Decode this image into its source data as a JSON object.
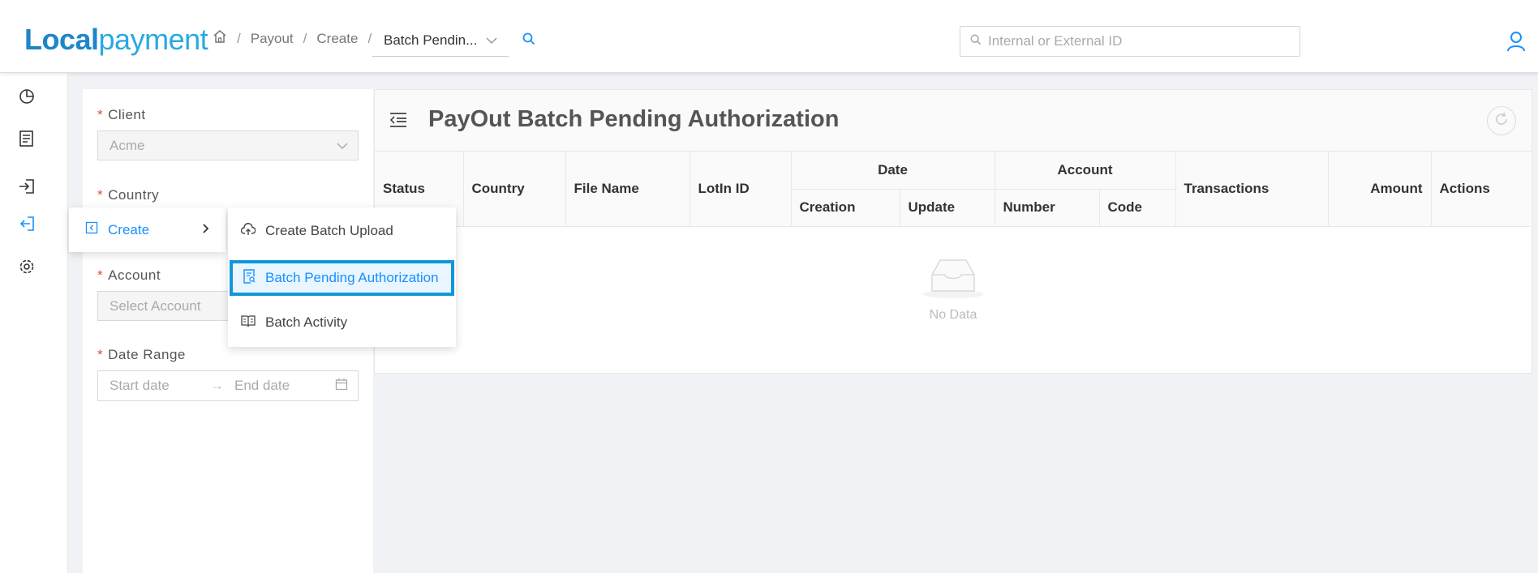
{
  "app": {
    "logo_part1": "Local",
    "logo_part2": "payment"
  },
  "breadcrumb": {
    "items": [
      "Payout",
      "Create"
    ],
    "separator": "/",
    "current": "Batch Pendin..."
  },
  "header": {
    "search_placeholder": "Internal or External ID"
  },
  "filters": {
    "client_label": "Client",
    "client_value": "Acme",
    "country_label": "Country",
    "account_label": "Account",
    "account_placeholder": "Select Account",
    "daterange_label": "Date Range",
    "start_placeholder": "Start date",
    "end_placeholder": "End date",
    "arrow": "→"
  },
  "card": {
    "title": "PayOut Batch Pending Authorization",
    "empty_text": "No Data"
  },
  "table": {
    "headers": {
      "status": "Status",
      "country": "Country",
      "file_name": "File Name",
      "lotin_id": "LotIn ID",
      "date": "Date",
      "creation": "Creation",
      "update": "Update",
      "account": "Account",
      "number": "Number",
      "code": "Code",
      "transactions": "Transactions",
      "amount": "Amount",
      "actions": "Actions"
    }
  },
  "menu": {
    "create_label": "Create",
    "items": [
      {
        "label": "Create Batch Upload",
        "icon": "cloud-upload-icon"
      },
      {
        "label": "Batch Pending Authorization",
        "icon": "file-search-icon"
      },
      {
        "label": "Batch Activity",
        "icon": "book-icon"
      }
    ]
  },
  "colors": {
    "accent": "#1890ff",
    "active_border": "#1296db",
    "required": "#e74c3c",
    "logo_dark": "#1d86c8",
    "logo_light": "#29a9e1"
  }
}
